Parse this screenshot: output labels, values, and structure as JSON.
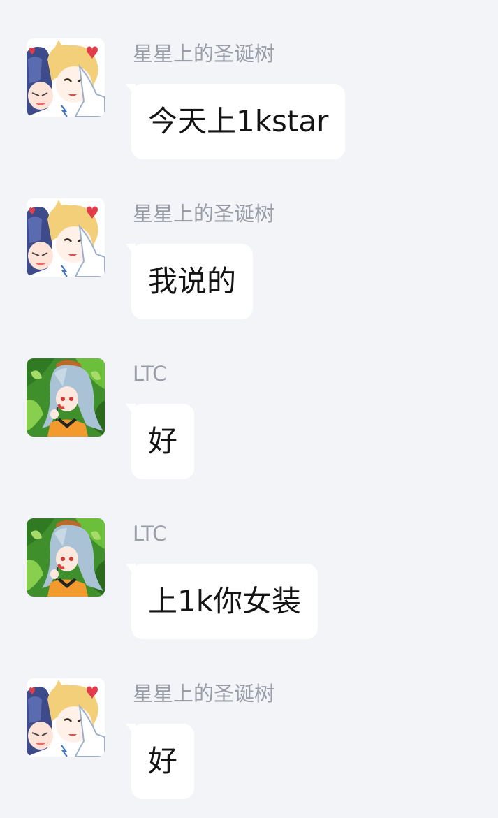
{
  "messages": [
    {
      "sender": "星星上的圣诞树",
      "text": "今天上1kstar",
      "avatar": "anime-couple-avatar"
    },
    {
      "sender": "星星上的圣诞树",
      "text": "我说的",
      "avatar": "anime-couple-avatar"
    },
    {
      "sender": "LTC",
      "text": "好",
      "avatar": "anime-girl-leaves-avatar"
    },
    {
      "sender": "LTC",
      "text": "上1k你女装",
      "avatar": "anime-girl-leaves-avatar"
    },
    {
      "sender": "星星上的圣诞树",
      "text": "好",
      "avatar": "anime-couple-avatar"
    }
  ],
  "colors": {
    "background": "#f3f4f8",
    "bubble": "#ffffff",
    "sender_name": "#9a9ca6",
    "message_text": "#141414"
  }
}
